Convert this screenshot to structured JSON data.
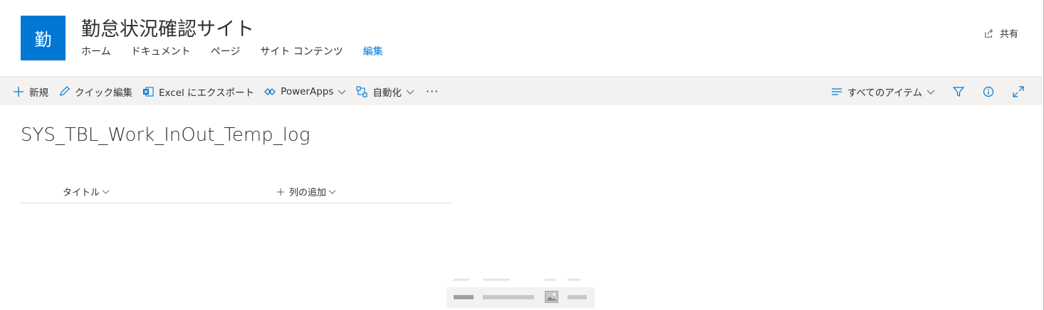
{
  "site": {
    "logo_text": "勤",
    "title": "勤怠状況確認サイト",
    "nav": [
      {
        "label": "ホーム"
      },
      {
        "label": "ドキュメント"
      },
      {
        "label": "ページ"
      },
      {
        "label": "サイト コンテンツ"
      },
      {
        "label": "編集"
      }
    ],
    "share_label": "共有"
  },
  "command_bar": {
    "new_label": "新規",
    "quick_edit_label": "クイック編集",
    "export_label": "Excel にエクスポート",
    "powerapps_label": "PowerApps",
    "automate_label": "自動化",
    "more_label": "···",
    "view_label": "すべてのアイテム"
  },
  "list": {
    "title": "SYS_TBL_Work_InOut_Temp_log",
    "columns": {
      "title_label": "タイトル",
      "add_label": "列の追加"
    }
  },
  "colors": {
    "accent": "#0078d4",
    "command_bar_bg": "#f3f2f1",
    "text": "#323130"
  }
}
